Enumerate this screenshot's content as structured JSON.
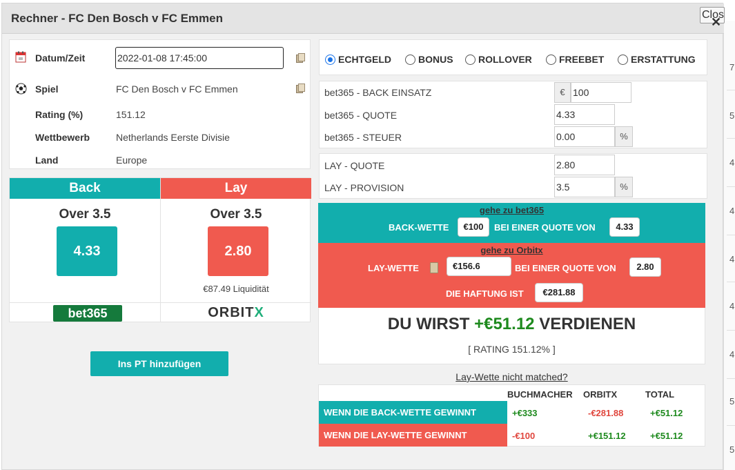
{
  "dialog": {
    "title": "Rechner - FC Den Bosch v FC Emmen",
    "close_label": "Close"
  },
  "edge_values": [
    "7.",
    "5.",
    "4.",
    "4.",
    "4.",
    "4.",
    "4.",
    "5.",
    "5."
  ],
  "info": {
    "datetime_label": "Datum/Zeit",
    "datetime_value": "2022-01-08 17:45:00",
    "match_label": "Spiel",
    "match_value": "FC Den Bosch v FC Emmen",
    "rating_label": "Rating (%)",
    "rating_value": "151.12",
    "competition_label": "Wettbewerb",
    "competition_value": "Netherlands Eerste Divisie",
    "country_label": "Land",
    "country_value": "Europe"
  },
  "back": {
    "header": "Back",
    "market": "Over 3.5",
    "odds": "4.33",
    "bookmaker_logo": "bet365"
  },
  "lay": {
    "header": "Lay",
    "market": "Over 3.5",
    "odds": "2.80",
    "liquidity": "€87.49 Liquidität",
    "exchange_logo_text": "ORBIT",
    "exchange_logo_x": "X"
  },
  "pt_button_label": "Ins PT hinzufügen",
  "bet_types": [
    {
      "label": "ECHTGELD",
      "checked": true
    },
    {
      "label": "BONUS",
      "checked": false
    },
    {
      "label": "ROLLOVER",
      "checked": false
    },
    {
      "label": "FREEBET",
      "checked": false
    },
    {
      "label": "ERSTATTUNG",
      "checked": false
    }
  ],
  "back_fields": {
    "stake_label": "bet365 - BACK EINSATZ",
    "currency": "€",
    "stake_value": "100",
    "odds_label": "bet365 - QUOTE",
    "odds_value": "4.33",
    "tax_label": "bet365 - STEUER",
    "tax_value": "0.00",
    "percent": "%"
  },
  "lay_fields": {
    "odds_label": "LAY - QUOTE",
    "odds_value": "2.80",
    "commission_label": "LAY - PROVISION",
    "commission_value": "3.5",
    "percent": "%"
  },
  "back_instruction": {
    "link": "gehe zu bet365",
    "prefix": "BACK-WETTE",
    "stake": "€100",
    "middle": "BEI EINER QUOTE VON",
    "odds": "4.33"
  },
  "lay_instruction": {
    "link": "gehe zu Orbitx",
    "prefix": "LAY-WETTE",
    "stake": "€156.6",
    "middle": "BEI EINER QUOTE VON",
    "odds": "2.80",
    "liability_label": "DIE HAFTUNG IST",
    "liability": "€281.88"
  },
  "profit": {
    "prefix": "DU WIRST",
    "amount": "+€51.12",
    "suffix": "VERDIENEN",
    "rating": "[ RATING 151.12% ]"
  },
  "not_matched_link": "Lay-Wette nicht matched?",
  "results": {
    "headers": [
      "BUCHMACHER",
      "ORBITX",
      "TOTAL"
    ],
    "rows": [
      {
        "label": "WENN DIE BACK-WETTE GEWINNT",
        "bookmaker": "+€333",
        "exchange": "-€281.88",
        "total": "+€51.12"
      },
      {
        "label": "WENN DIE LAY-WETTE GEWINNT",
        "bookmaker": "-€100",
        "exchange": "+€151.12",
        "total": "+€51.12"
      }
    ]
  },
  "colors": {
    "back": "#12aead",
    "lay": "#f05a4f",
    "profit_green": "#1e8a1e",
    "loss_red": "#e0463d",
    "radio_accent": "#1a73e8"
  }
}
